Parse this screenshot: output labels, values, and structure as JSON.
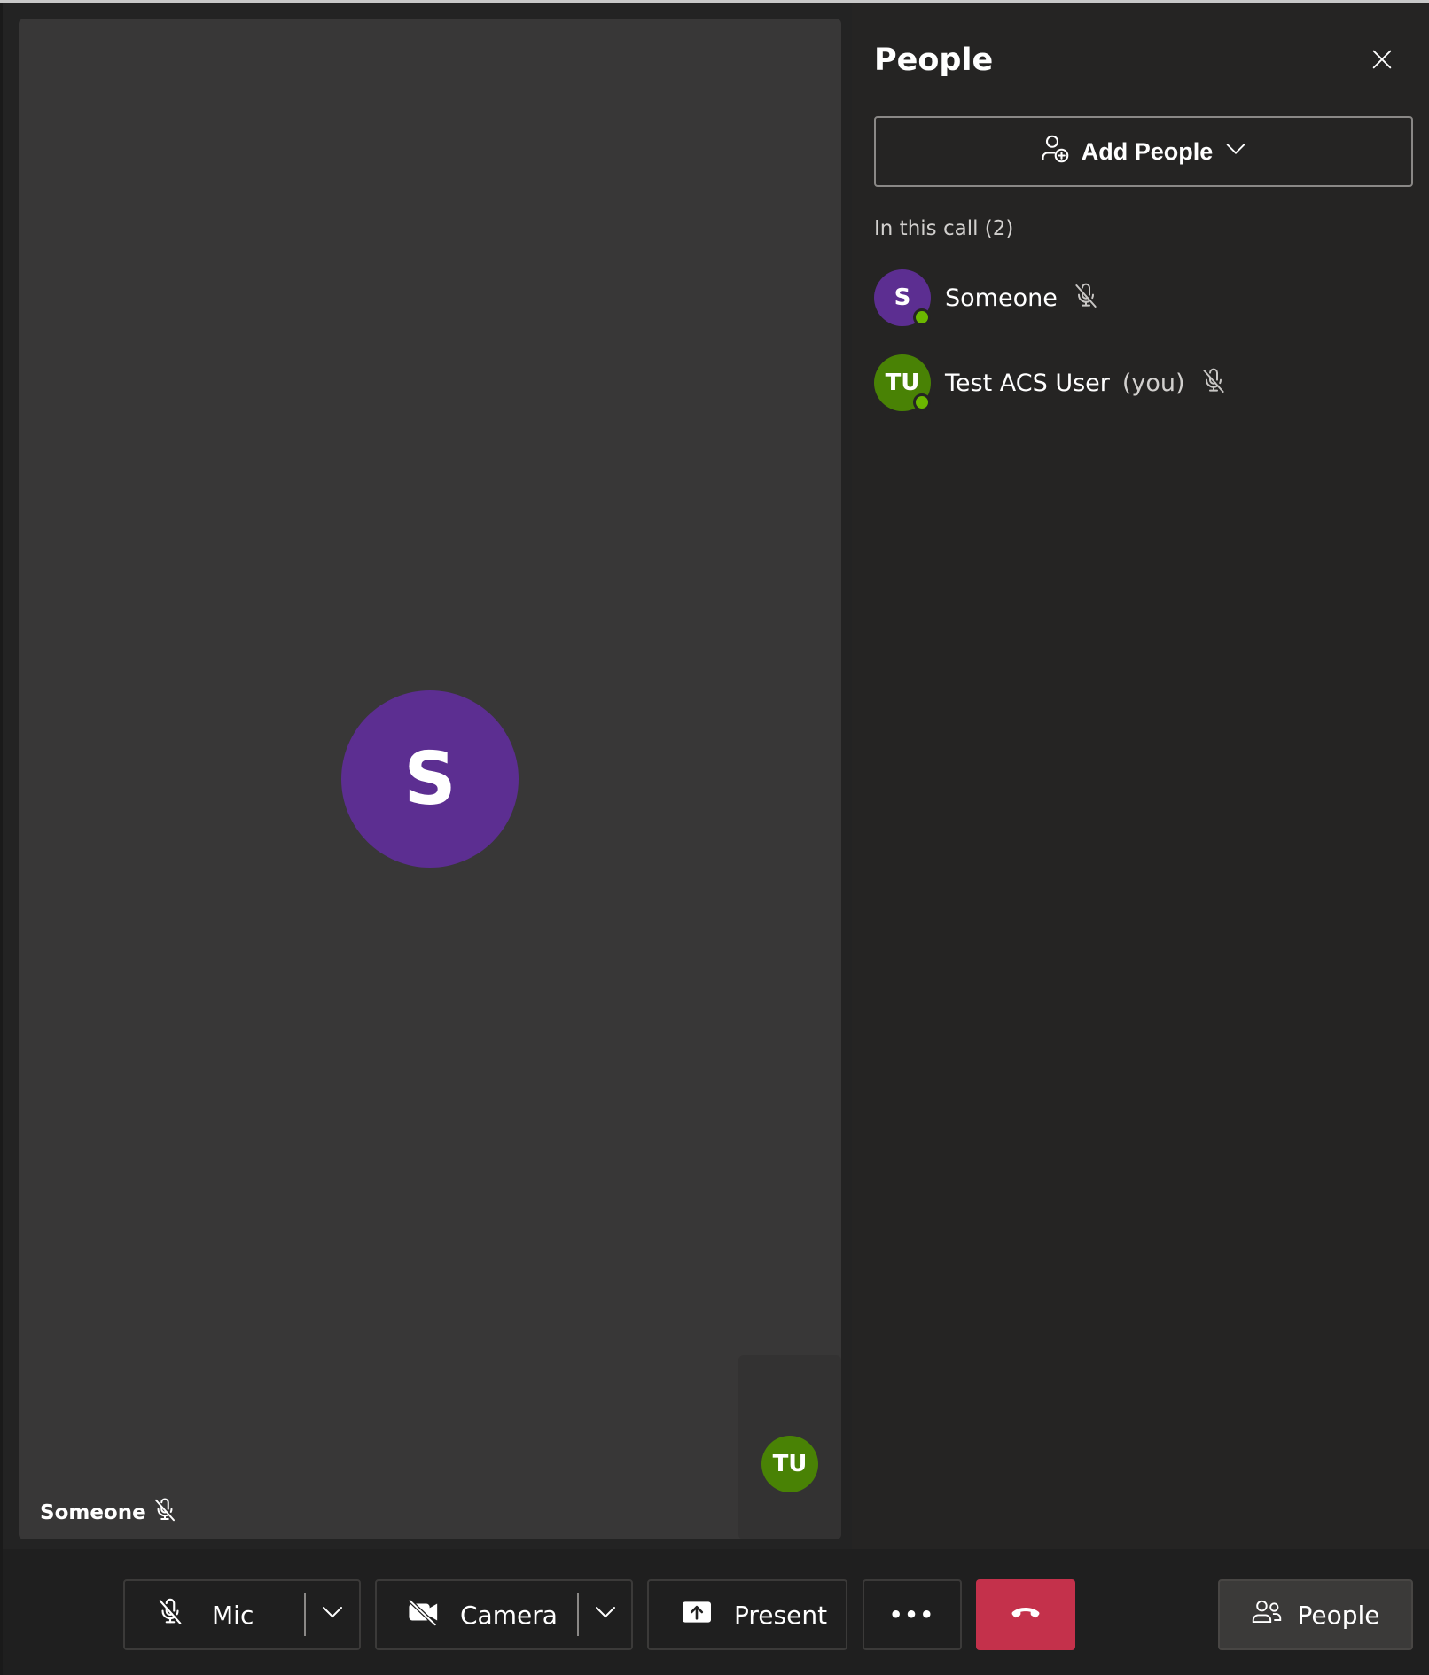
{
  "stage": {
    "main_participant": {
      "initials": "S",
      "name": "Someone",
      "avatar_color": "#5c2e91",
      "muted": true
    },
    "local_participant": {
      "initials": "TU",
      "avatar_color": "#498205"
    }
  },
  "people_panel": {
    "title": "People",
    "add_people_label": "Add People",
    "section_label": "In this call (2)",
    "participants": [
      {
        "initials": "S",
        "name": "Someone",
        "suffix": "",
        "avatar_color": "#5c2e91",
        "presence": "available",
        "muted": true
      },
      {
        "initials": "TU",
        "name": "Test ACS User",
        "suffix": "(you)",
        "avatar_color": "#498205",
        "presence": "available",
        "muted": true
      }
    ]
  },
  "controls": {
    "mic_label": "Mic",
    "camera_label": "Camera",
    "present_label": "Present",
    "more_label": "•••",
    "people_label": "People",
    "end_call_color": "#c4314b"
  },
  "icons": {
    "close": "close-icon",
    "add_person": "person-add-icon",
    "chevron": "chevron-down-icon",
    "mic_off": "mic-off-icon",
    "camera_off": "camera-off-icon",
    "share": "share-screen-icon",
    "more": "more-icon",
    "hang_up": "hang-up-icon",
    "people": "people-icon"
  }
}
